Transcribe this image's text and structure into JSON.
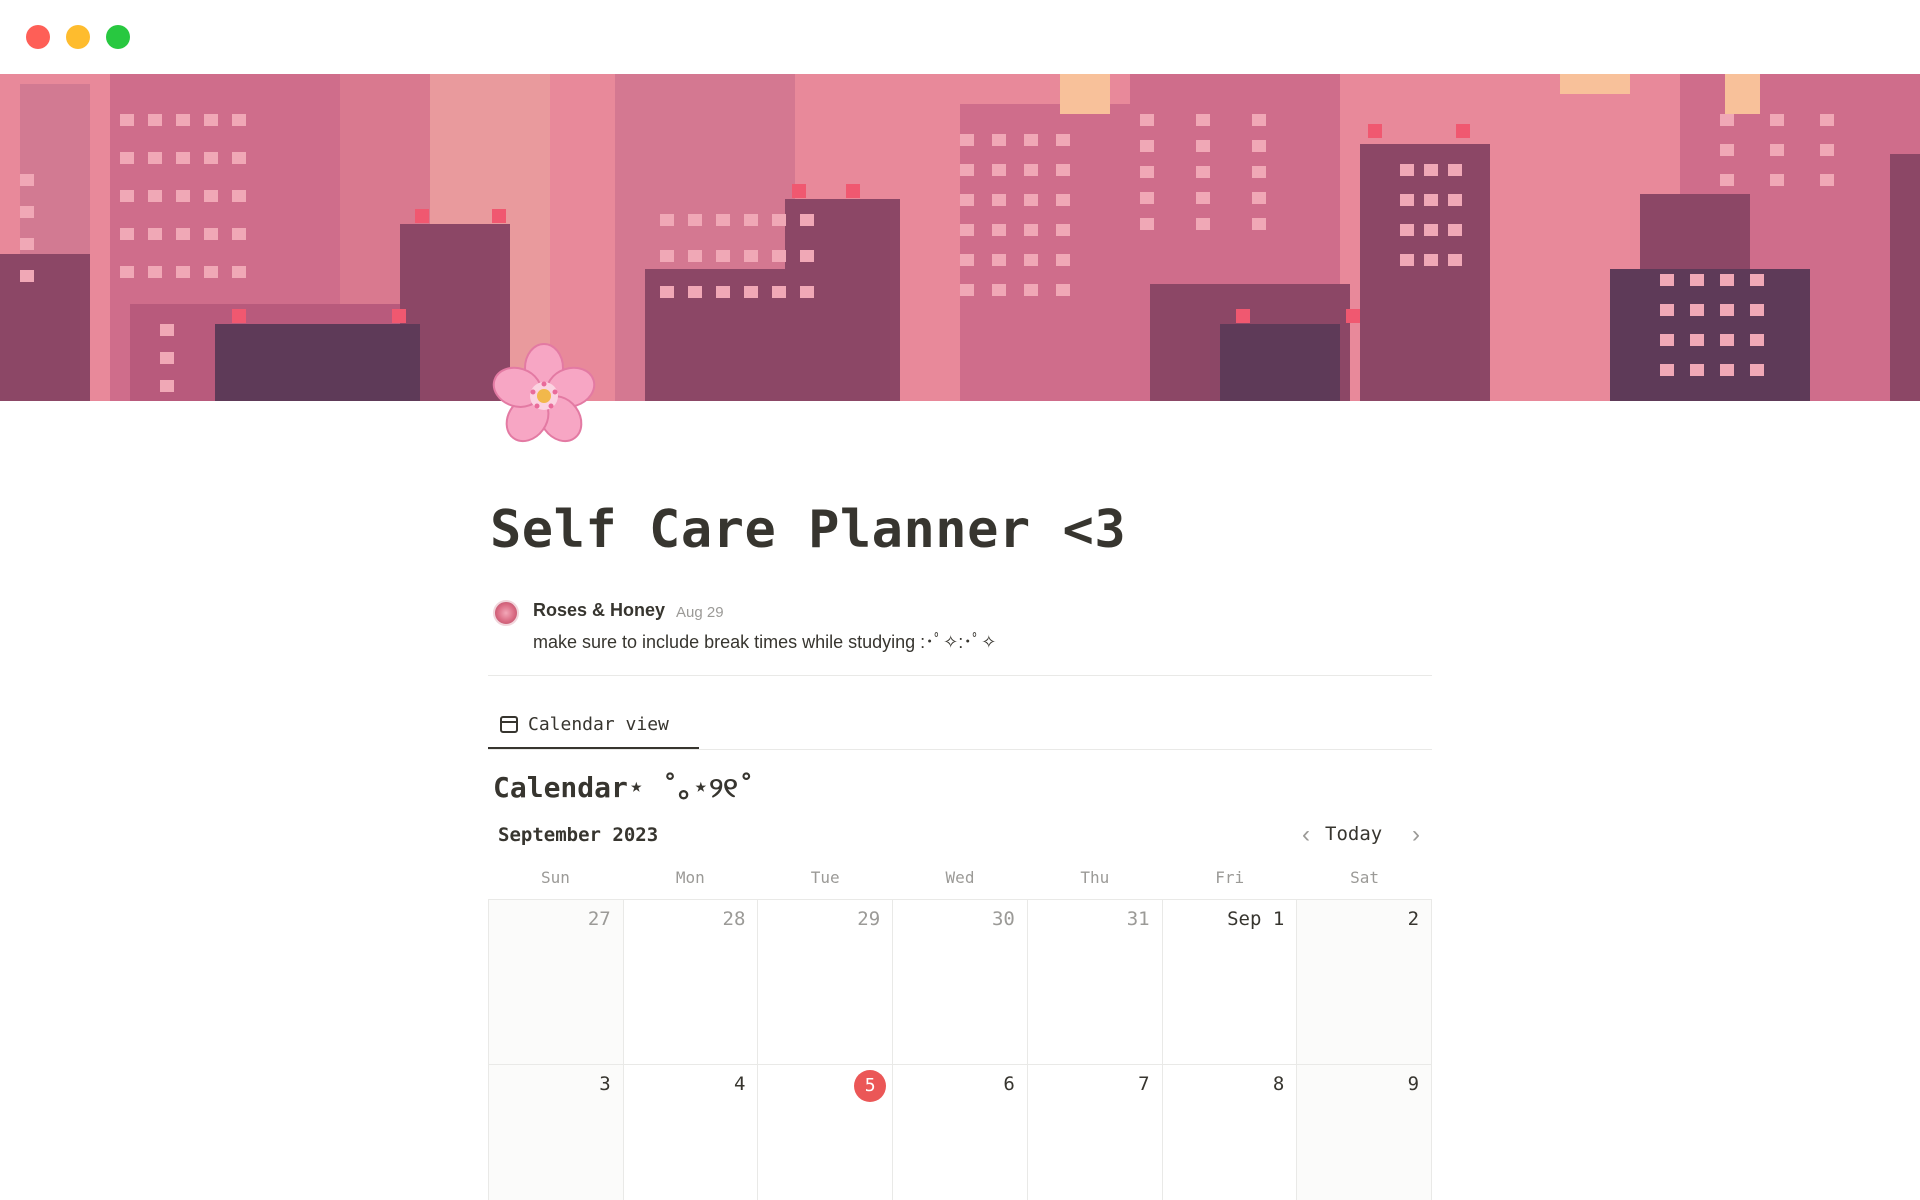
{
  "window": {
    "controls": [
      "close",
      "minimize",
      "zoom"
    ]
  },
  "cover": {
    "description_icon": "pixel-city-skyline"
  },
  "page": {
    "icon": "cherry-blossom-icon",
    "title": "Self Care Planner <3"
  },
  "comment": {
    "author": "Roses & Honey",
    "date": "Aug 29",
    "text": "make sure to include break times while studying :･ﾟ✧:･ﾟ✧"
  },
  "tabs": [
    {
      "label": "Calendar view",
      "icon": "calendar-icon",
      "active": true
    }
  ],
  "calendar": {
    "title": "Calendar⋆ ˚｡⋆୨୧˚",
    "month_label": "September 2023",
    "today_label": "Today",
    "prev_icon": "chevron-left-icon",
    "next_icon": "chevron-right-icon",
    "weekdays": [
      "Sun",
      "Mon",
      "Tue",
      "Wed",
      "Thu",
      "Fri",
      "Sat"
    ],
    "weeks": [
      [
        "27",
        "28",
        "29",
        "30",
        "31",
        "Sep 1",
        "2"
      ],
      [
        "3",
        "4",
        "5",
        "6",
        "7",
        "8",
        "9"
      ]
    ],
    "today_date": "5"
  },
  "colors": {
    "today_badge": "#eb5757",
    "text_primary": "#37352f",
    "text_muted": "#9b9a97",
    "cover_sky": "#e8899a",
    "cover_building": "#c96a86",
    "cover_dark": "#8c4766"
  }
}
